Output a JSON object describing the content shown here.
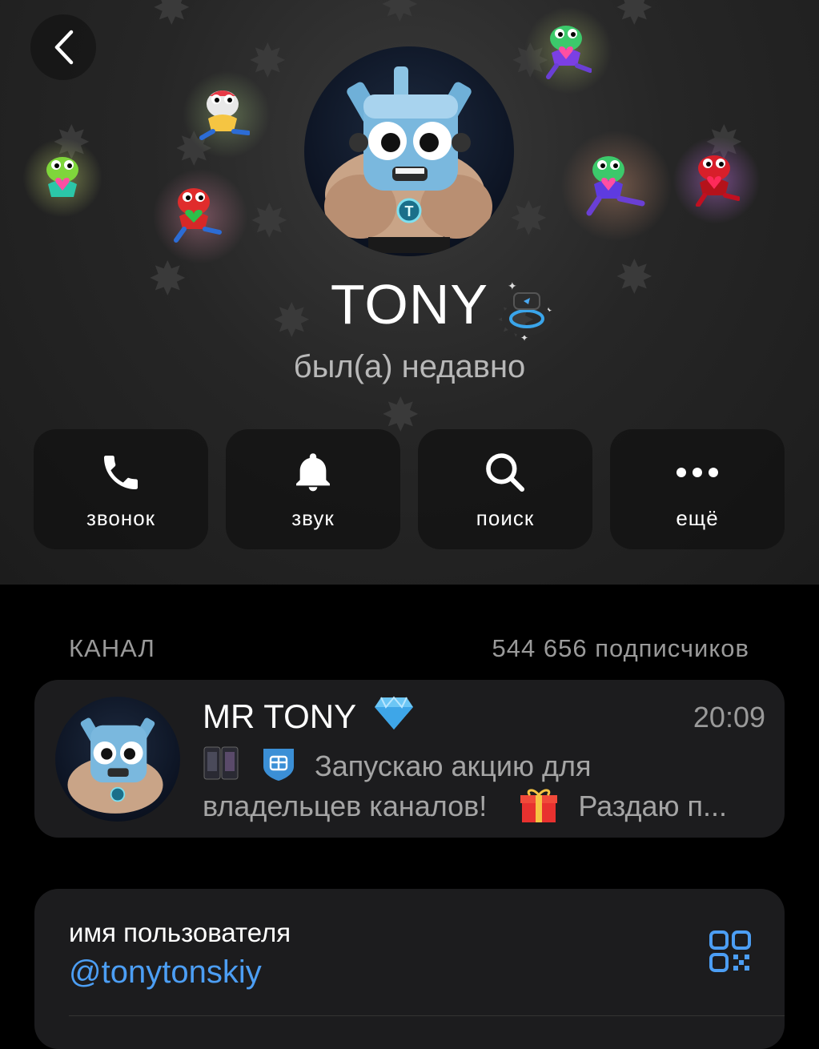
{
  "profile": {
    "name": "TONY",
    "status": "был(а) недавно"
  },
  "actions": [
    {
      "label": "звонок",
      "icon": "phone-icon"
    },
    {
      "label": "звук",
      "icon": "bell-icon"
    },
    {
      "label": "поиск",
      "icon": "search-icon"
    },
    {
      "label": "ещё",
      "icon": "more-icon"
    }
  ],
  "channel_section": {
    "label": "КАНАЛ",
    "subscribers": "544 656 подписчиков"
  },
  "channel_post": {
    "title": "MR TONY",
    "time": "20:09",
    "line1": "Запускаю акцию для",
    "line2_a": "владельцев каналов!",
    "line2_b": "Раздаю п..."
  },
  "username": {
    "label": "имя пользователя",
    "value": "@tonytonskiy"
  },
  "colors": {
    "accent": "#4c9ef4",
    "card": "#1c1c1e",
    "background": "#000000"
  }
}
